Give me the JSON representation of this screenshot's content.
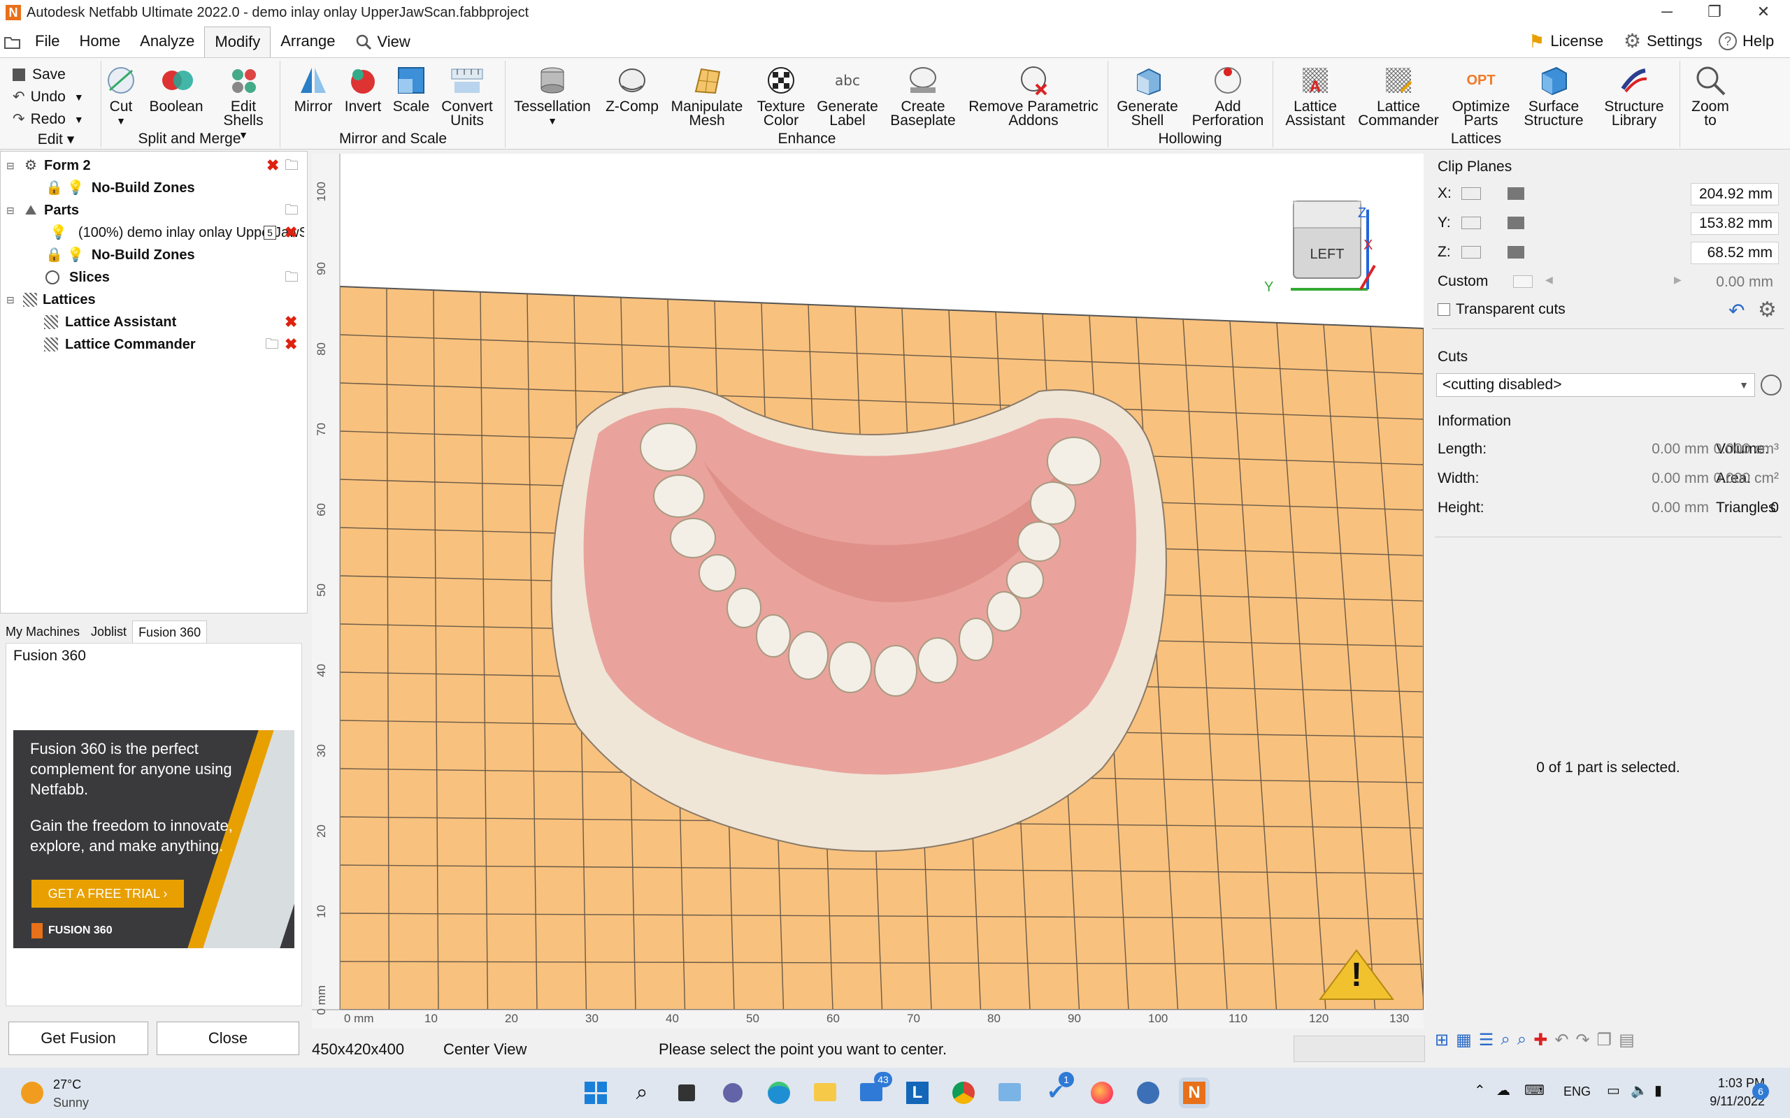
{
  "window": {
    "title": "Autodesk Netfabb Ultimate 2022.0 - demo inlay onlay UpperJawScan.fabbproject",
    "logo_letter": "N"
  },
  "menu": {
    "items": [
      "File",
      "Home",
      "Analyze",
      "Modify",
      "Arrange",
      "View"
    ],
    "active": "Modify",
    "right": [
      "License",
      "Settings",
      "Help"
    ]
  },
  "ribbon": {
    "edit": {
      "save": "Save",
      "undo": "Undo",
      "redo": "Redo",
      "group": "Edit"
    },
    "split_merge": {
      "buttons": [
        "Cut",
        "Boolean",
        "Edit Shells"
      ],
      "group": "Split and Merge"
    },
    "mirror_scale": {
      "buttons": [
        "Mirror",
        "Invert",
        "Scale",
        "Convert Units"
      ],
      "group": "Mirror and Scale"
    },
    "enhance": {
      "buttons": [
        "Tessellation",
        "Z-Comp",
        "Manipulate Mesh",
        "Texture Color",
        "Generate Label",
        "Create Baseplate",
        "Remove Parametric Addons"
      ],
      "group": "Enhance",
      "label_icon_text": "abc"
    },
    "hollowing": {
      "buttons": [
        "Generate Shell",
        "Add Perforation"
      ],
      "group": "Hollowing"
    },
    "lattices": {
      "buttons": [
        "Lattice Assistant",
        "Lattice Commander",
        "Optimize Parts",
        "Surface Structure",
        "Structure Library"
      ],
      "group": "Lattices",
      "opt_icon_text": "OPT"
    },
    "zoom": {
      "label": "Zoom to"
    }
  },
  "tree": {
    "form": "Form 2",
    "form_child": "No-Build Zones",
    "parts": "Parts",
    "part_item": "(100%) demo inlay onlay UpperJawScan",
    "part_badge": "5",
    "parts_child": "No-Build Zones",
    "slices": "Slices",
    "lattices": "Lattices",
    "lattice_items": [
      "Lattice Assistant",
      "Lattice Commander"
    ]
  },
  "bottom_tabs": [
    "My Machines",
    "Joblist",
    "Fusion 360"
  ],
  "fusion": {
    "heading": "Fusion 360",
    "ad_line1": "Fusion 360 is the perfect complement for anyone using Netfabb.",
    "ad_line2": "Gain the freedom to innovate, explore, and make anything.",
    "ad_cta": "GET A FREE TRIAL  ›",
    "ad_brand": "FUSION 360",
    "get_button": "Get Fusion",
    "close_button": "Close"
  },
  "viewport": {
    "y_ticks": [
      "100",
      "90",
      "80",
      "70",
      "60",
      "50",
      "40",
      "30",
      "20",
      "10",
      "0 mm"
    ],
    "x_ticks": [
      "0 mm",
      "10",
      "20",
      "30",
      "40",
      "50",
      "60",
      "70",
      "80",
      "90",
      "100",
      "110",
      "120",
      "130"
    ],
    "cube_face": "LEFT",
    "axis_y": "Y",
    "axis_z": "Z",
    "axis_x": "X",
    "warning_symbol": "!"
  },
  "clip_planes": {
    "title": "Clip Planes",
    "x_label": "X:",
    "x_value": "204.92 mm",
    "y_label": "Y:",
    "y_value": "153.82 mm",
    "z_label": "Z:",
    "z_value": "68.52 mm",
    "custom_label": "Custom",
    "custom_value": "0.00 mm",
    "transparent": "Transparent cuts"
  },
  "cuts": {
    "title": "Cuts",
    "select_value": "<cutting disabled>"
  },
  "information": {
    "title": "Information",
    "length_label": "Length:",
    "length_value": "0.00 mm",
    "width_label": "Width:",
    "width_value": "0.00 mm",
    "height_label": "Height:",
    "height_value": "0.00 mm",
    "volume_label": "Volume:",
    "volume_value": "0.000 cm³",
    "area_label": "Area:",
    "area_value": "0.000 cm²",
    "triangles_label": "Triangles",
    "triangles_value": "0",
    "selection_text": "0 of 1 part is selected."
  },
  "status": {
    "dims": "450x420x400",
    "mode": "Center View",
    "message": "Please select the point you want to center."
  },
  "taskbar": {
    "weather_temp": "27°C",
    "weather_desc": "Sunny",
    "mail_badge": "43",
    "todo_badge": "1",
    "lang": "ENG",
    "time": "1:03 PM",
    "date": "9/11/2022",
    "notif_count": "6"
  }
}
